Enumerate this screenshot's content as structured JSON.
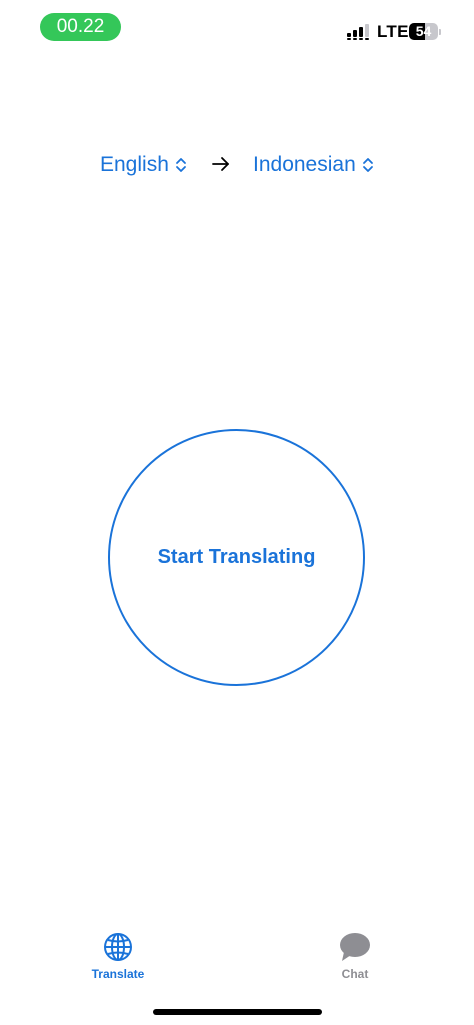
{
  "status_bar": {
    "time": "00.22",
    "network": "LTE",
    "battery_level": "54",
    "battery_fraction": 0.54,
    "colors": {
      "time_pill": "#34c759"
    }
  },
  "language_selector": {
    "source_language": "English",
    "target_language": "Indonesian",
    "icons": {
      "chevron": "chevron-updown-icon",
      "arrow": "arrow-right-icon"
    }
  },
  "main": {
    "start_button_label": "Start Translating"
  },
  "tab_bar": {
    "tabs": [
      {
        "label": "Translate",
        "icon": "globe-icon",
        "selected": true
      },
      {
        "label": "Chat",
        "icon": "chat-bubble-icon",
        "selected": false
      }
    ]
  },
  "colors": {
    "accent": "#1a73d9",
    "inactive": "#8e8e93",
    "background": "#ffffff"
  }
}
